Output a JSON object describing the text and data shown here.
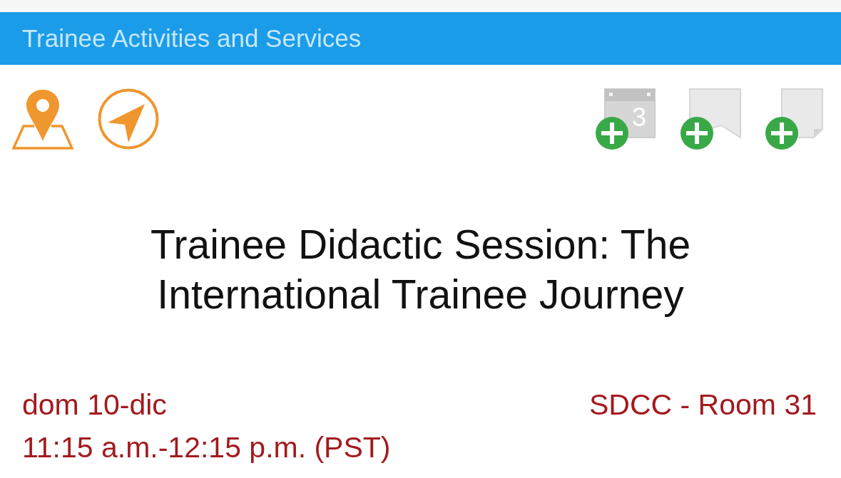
{
  "header": {
    "title": "Trainee Activities and Services"
  },
  "actions": [
    {
      "kind": "calendar",
      "day": "3"
    },
    {
      "kind": "bookmark"
    },
    {
      "kind": "note"
    }
  ],
  "session": {
    "title": "Trainee Didactic Session: The International Trainee Journey",
    "date": "dom 10-dic",
    "time": "11:15 a.m.-12:15 p.m. (PST)",
    "location": "SDCC - Room 31"
  }
}
